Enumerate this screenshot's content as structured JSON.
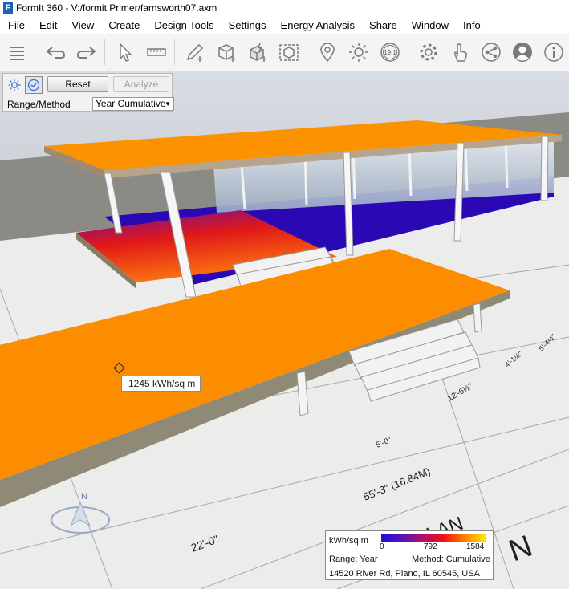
{
  "window": {
    "title": "FormIt 360 - V:/formit Primer/farnsworth07.axm",
    "app_icon_letter": "F"
  },
  "menu": [
    "File",
    "Edit",
    "View",
    "Create",
    "Design Tools",
    "Settings",
    "Energy Analysis",
    "Share",
    "Window",
    "Info"
  ],
  "toolbar": {
    "icons": [
      "layers-icon",
      "undo-icon",
      "redo-icon",
      "select-arrow-icon",
      "measure-tape-icon",
      "draw-pencil-icon",
      "add-cube-icon",
      "add-object-icon",
      "group-box-icon",
      "location-pin-icon",
      "sun-icon",
      "version-badge-icon",
      "settings-gear-icon",
      "gesture-hand-icon",
      "share-network-icon",
      "account-icon",
      "info-icon"
    ],
    "badge_label": "19.1"
  },
  "panel": {
    "reset_label": "Reset",
    "analyze_label": "Analyze",
    "range_label": "Range/Method",
    "range_value": "Year Cumulative"
  },
  "tooltip": {
    "text": "1245 kWh/sq m"
  },
  "legend": {
    "unit": "kWh/sq m",
    "ticks": [
      "0",
      "792",
      "1584"
    ],
    "range_text": "Range: Year",
    "method_text": "Method: Cumulative",
    "address": "14520 River Rd, Plano, IL 60545, USA"
  },
  "drawing": {
    "dims": [
      "22'-0\"",
      "55'-3\" (16.84M)",
      "5'-0\"",
      "12'-6½\"",
      "4'-1½\"",
      "5'-4½\""
    ],
    "plan_text": "PLAN",
    "north_letter": "N",
    "compass_letter": "N"
  },
  "colors": {
    "roof": "#fc9200",
    "floor_cool": "#2a08b4",
    "floor_hot": "#ff8600",
    "sky": "#c9ccd2",
    "ground": "#8a8b84"
  }
}
